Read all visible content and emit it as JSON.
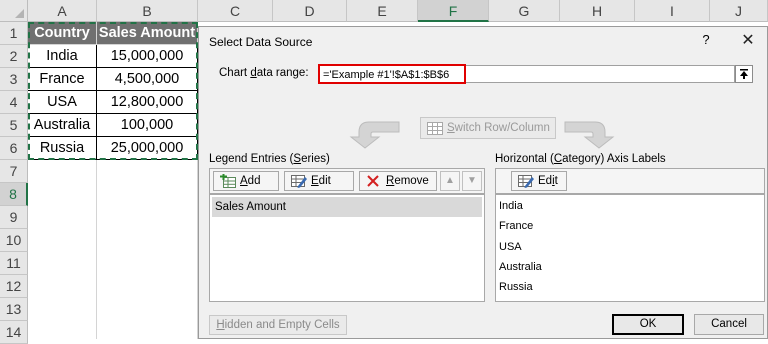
{
  "sheet": {
    "columns": [
      "A",
      "B",
      "C",
      "D",
      "E",
      "F",
      "G",
      "H",
      "I",
      "J"
    ],
    "selected_column": "F",
    "rows": [
      "1",
      "2",
      "3",
      "4",
      "5",
      "6",
      "7",
      "8",
      "9",
      "10",
      "11",
      "12",
      "13",
      "14"
    ],
    "selected_row": "8",
    "table": {
      "headers": [
        "Country",
        "Sales Amount"
      ],
      "rows": [
        [
          "India",
          "15,000,000"
        ],
        [
          "France",
          "4,500,000"
        ],
        [
          "USA",
          "12,800,000"
        ],
        [
          "Australia",
          "100,000"
        ],
        [
          "Russia",
          "25,000,000"
        ]
      ]
    },
    "colors": {
      "header_bg": "#707070",
      "selection": "#217346"
    }
  },
  "dialog": {
    "title": "Select Data Source",
    "help": "?",
    "close": "✕",
    "range_label_pre": "Chart ",
    "range_label_u": "d",
    "range_label_post": "ata range:",
    "range_value": "='Example #1'!$A$1:$B$6",
    "switch_pre": "",
    "switch_u": "S",
    "switch_post": "witch Row/Column",
    "legend_label_pre": "Legend Entries (",
    "legend_label_u": "S",
    "legend_label_post": "eries)",
    "add_pre": "",
    "add_u": "A",
    "add_post": "dd",
    "edit_pre": "",
    "edit_u": "E",
    "edit_post": "dit",
    "remove_pre": "",
    "remove_u": "R",
    "remove_post": "emove",
    "up_arrow": "▲",
    "down_arrow": "▼",
    "series": [
      "Sales Amount"
    ],
    "axis_label_pre": "Horizontal (",
    "axis_label_u": "C",
    "axis_label_post": "ategory) Axis Labels",
    "axis_edit_pre": "Ed",
    "axis_edit_u": "i",
    "axis_edit_post": "t",
    "categories": [
      "India",
      "France",
      "USA",
      "Australia",
      "Russia"
    ],
    "hidden_pre": "",
    "hidden_u": "H",
    "hidden_post": "idden and Empty Cells",
    "ok": "OK",
    "cancel": "Cancel",
    "colors": {
      "range_border": "#e00000",
      "remove_icon": "#d42020"
    }
  }
}
